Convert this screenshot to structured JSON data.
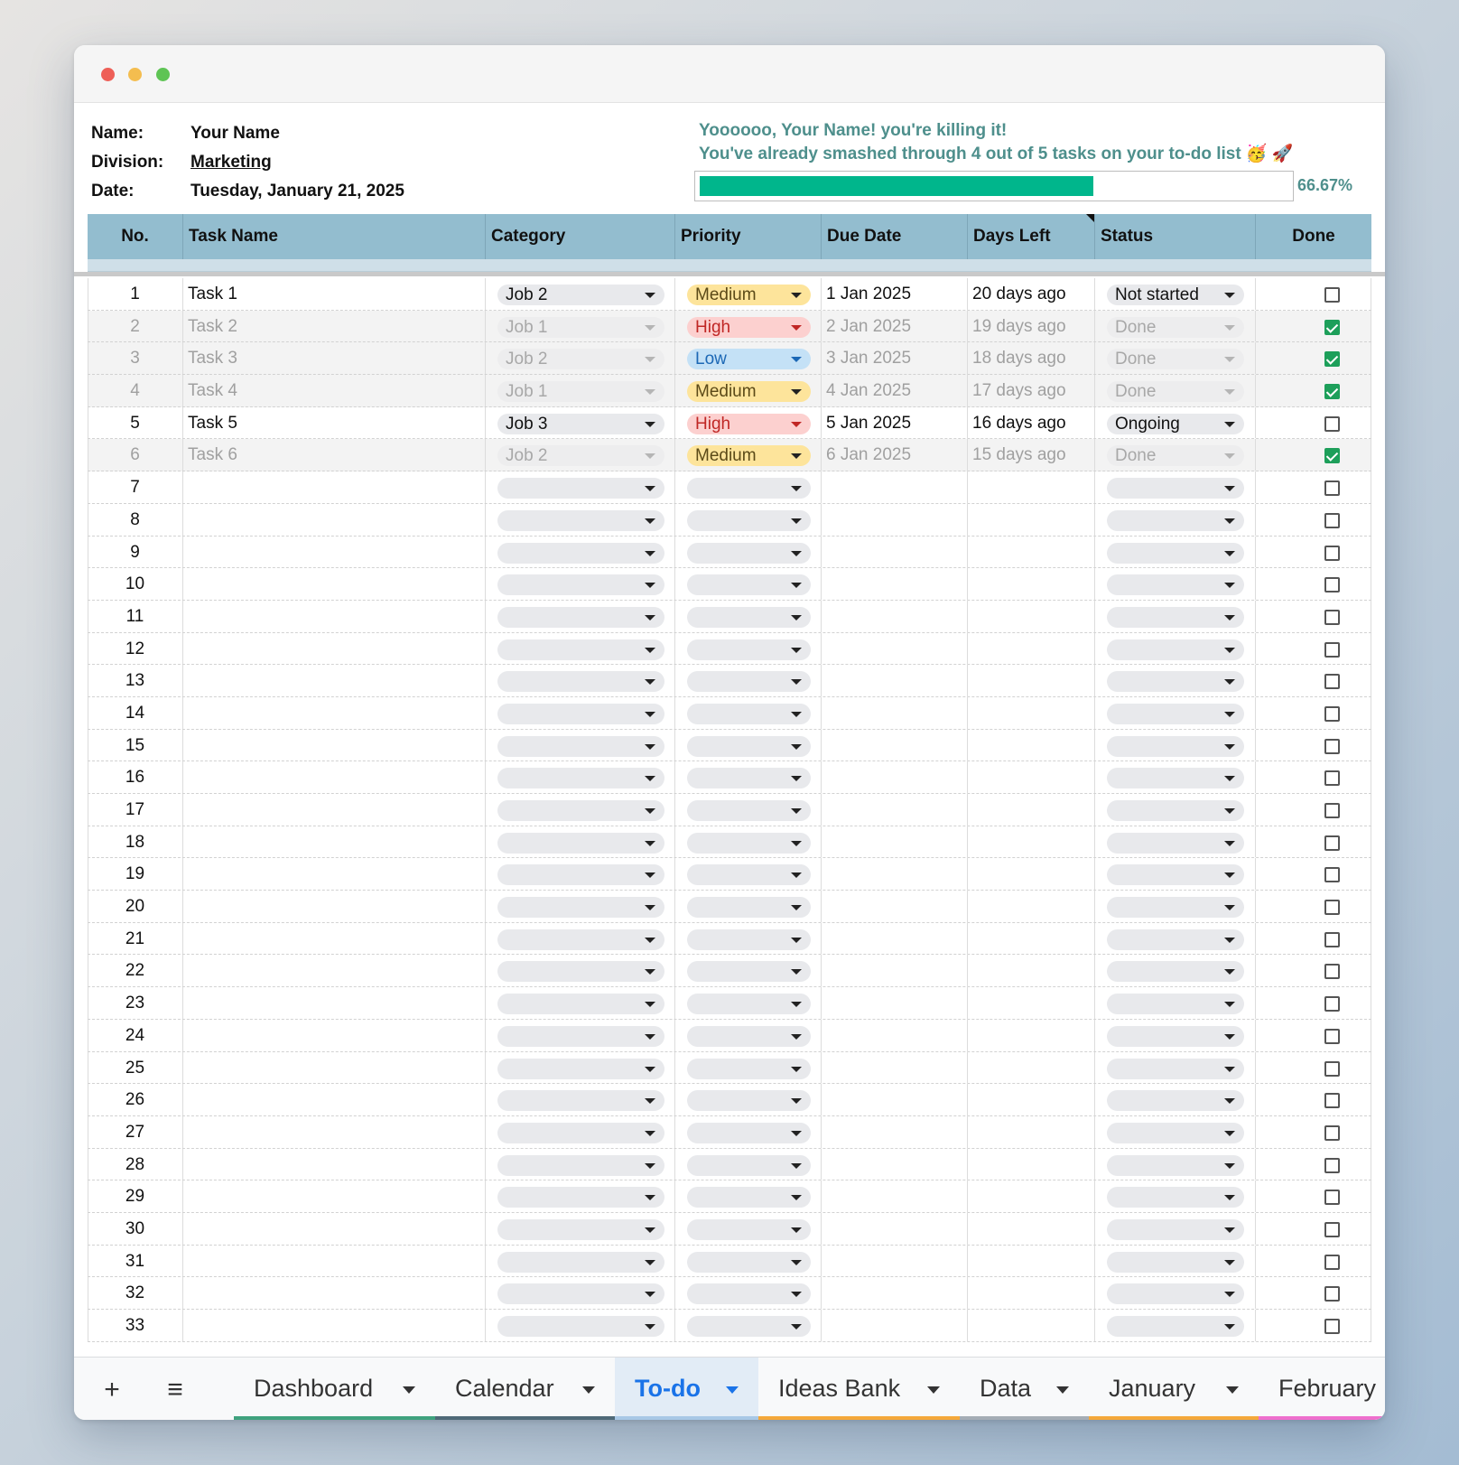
{
  "header": {
    "name_label": "Name:",
    "name_value": "Your Name",
    "division_label": "Division:",
    "division_value": "Marketing",
    "date_label": "Date:",
    "date_value": "Tuesday, January 21, 2025",
    "message_line1": "Yoooooo, Your Name! you're killing it!",
    "message_line2": "You've already smashed through 4 out of 5 tasks on your to-do list 🥳 🚀",
    "progress_percent": 66.67,
    "progress_label": "66.67%",
    "progress_color": "#00b68c"
  },
  "columns": [
    "No.",
    "Task Name",
    "Category",
    "Priority",
    "Due Date",
    "Days Left",
    "Status",
    "Done"
  ],
  "tasks": [
    {
      "no": "1",
      "name": "Task 1",
      "category": "Job 2",
      "priority": "Medium",
      "due": "1 Jan 2025",
      "days_left": "20 days ago",
      "status": "Not started",
      "done": false
    },
    {
      "no": "2",
      "name": "Task 2",
      "category": "Job 1",
      "priority": "High",
      "due": "2 Jan 2025",
      "days_left": "19 days ago",
      "status": "Done",
      "done": true
    },
    {
      "no": "3",
      "name": "Task 3",
      "category": "Job 2",
      "priority": "Low",
      "due": "3 Jan 2025",
      "days_left": "18 days ago",
      "status": "Done",
      "done": true
    },
    {
      "no": "4",
      "name": "Task 4",
      "category": "Job 1",
      "priority": "Medium",
      "due": "4 Jan 2025",
      "days_left": "17 days ago",
      "status": "Done",
      "done": true
    },
    {
      "no": "5",
      "name": "Task 5",
      "category": "Job 3",
      "priority": "High",
      "due": "5 Jan 2025",
      "days_left": "16 days ago",
      "status": "Ongoing",
      "done": false
    },
    {
      "no": "6",
      "name": "Task 6",
      "category": "Job 2",
      "priority": "Medium",
      "due": "6 Jan 2025",
      "days_left": "15 days ago",
      "status": "Done",
      "done": true
    }
  ],
  "empty_row_numbers": [
    "7",
    "8",
    "9",
    "10",
    "11",
    "12",
    "13",
    "14",
    "15",
    "16",
    "17",
    "18",
    "19",
    "20",
    "21",
    "22",
    "23",
    "24",
    "25",
    "26",
    "27",
    "28",
    "29",
    "30",
    "31",
    "32",
    "33"
  ],
  "priority_colors": {
    "Medium": "#fde49b",
    "High": "#fcd0cf",
    "Low": "#c4e1f6"
  },
  "done_check_color": "#1d9f5a",
  "header_color": "#93bdcf",
  "toolbar": {
    "add_icon": "plus-icon",
    "menu_icon": "menu-icon"
  },
  "sheet_tabs": [
    {
      "label": "Dashboard",
      "color": "#3fa27e",
      "active": false
    },
    {
      "label": "Calendar",
      "color": "#4f6a78",
      "active": false
    },
    {
      "label": "To-do",
      "color": "#a8c8e6",
      "active": true
    },
    {
      "label": "Ideas Bank",
      "color": "#f4a83a",
      "active": false
    },
    {
      "label": "Data",
      "color": "#a5adb5",
      "active": false
    },
    {
      "label": "January",
      "color": "#f4a83a",
      "active": false
    },
    {
      "label": "February",
      "color": "#ee6fcd",
      "active": false
    }
  ]
}
